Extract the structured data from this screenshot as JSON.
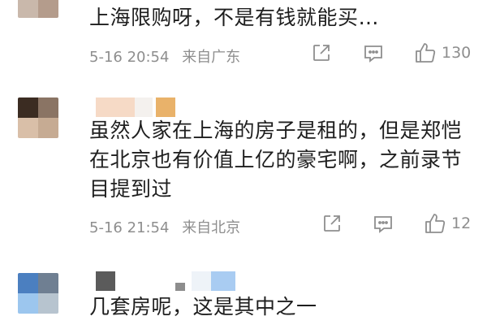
{
  "colors": {
    "text": "#1e1e1e",
    "meta": "#8e8e8e",
    "icon": "#8e8e8e",
    "background": "#ffffff"
  },
  "comments": [
    {
      "text": "上海限购呀，不是有钱就能买…",
      "date": "5-16 20:54",
      "location": "来自广东",
      "likes": "130",
      "icons": [
        "share-icon",
        "comment-icon",
        "like-icon"
      ]
    },
    {
      "text": "虽然人家在上海的房子是租的，但是郑恺在北京也有价值上亿的豪宅啊，之前录节目提到过",
      "date": "5-16 21:54",
      "location": "来自北京",
      "likes": "12",
      "icons": [
        "share-icon",
        "comment-icon",
        "like-icon"
      ]
    },
    {
      "text": "几套房呢，这是其中之一"
    }
  ]
}
